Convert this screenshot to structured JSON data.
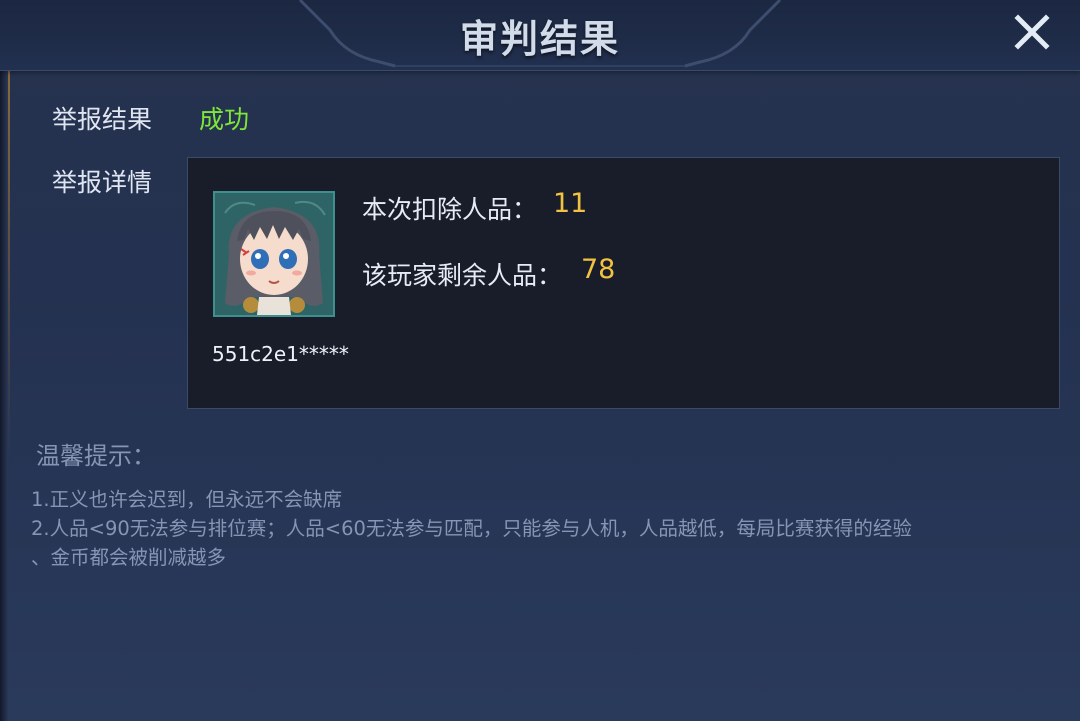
{
  "dialog": {
    "title": "审判结果",
    "close_icon": "close-icon"
  },
  "report": {
    "result_label": "举报结果",
    "result_value": "成功",
    "details_label": "举报详情"
  },
  "player": {
    "avatar_icon": "player-avatar",
    "id": "551c2e1*****",
    "deducted_label": "本次扣除人品：",
    "deducted_value": "11",
    "remaining_label": "该玩家剩余人品：",
    "remaining_value": "78"
  },
  "tips": {
    "title": "温馨提示：",
    "line1": "1.正义也许会迟到，但永远不会缺席",
    "line2": "2.人品<90无法参与排位赛；人品<60无法参与匹配，只能参与人机，人品越低，每局比赛获得的经验",
    "line3": "、金币都会被削减越多"
  },
  "colors": {
    "success": "#7ee63a",
    "value_gold": "#f2c342",
    "tip_text": "#8595b3"
  }
}
